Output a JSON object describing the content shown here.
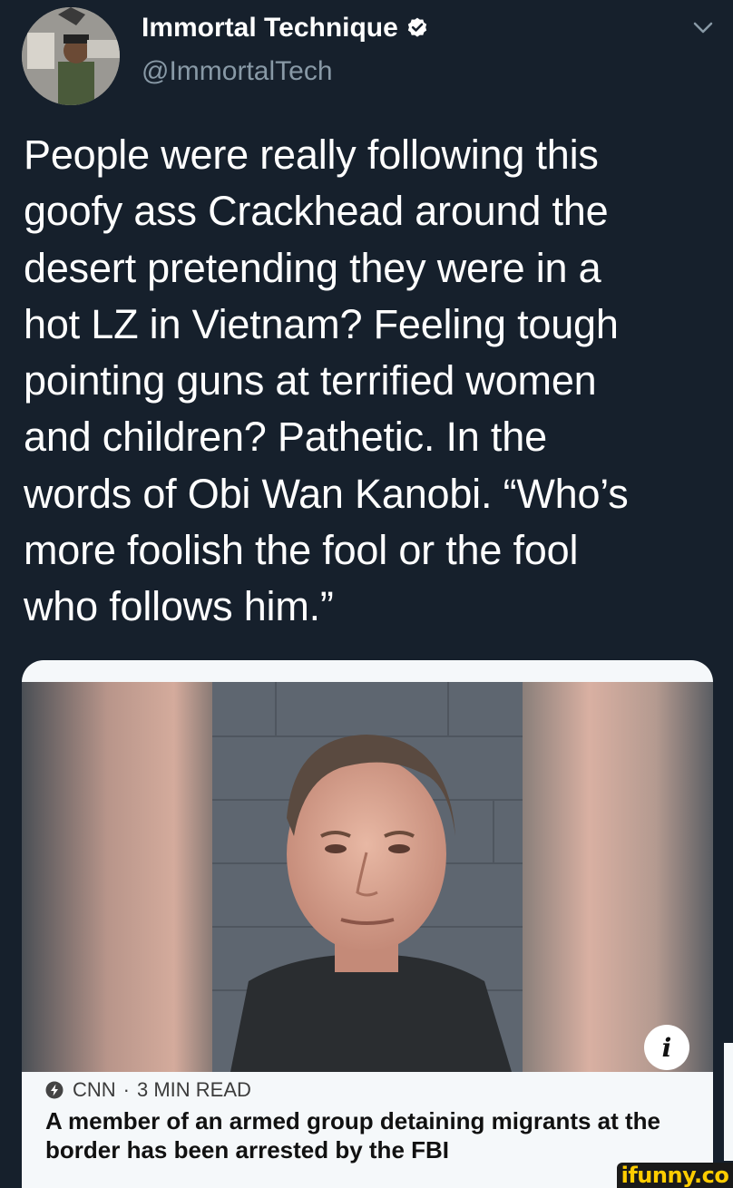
{
  "tweet": {
    "author": {
      "display_name": "Immortal Technique",
      "handle": "@ImmortalTech",
      "verified": true,
      "avatar_icon": "profile-photo"
    },
    "menu_icon": "chevron-down-icon",
    "text": "People were really following this\ngoofy ass Crackhead around the\ndesert pretending they were in a\nhot LZ in Vietnam? Feeling tough\npointing guns at terrified women\nand children? Pathetic. In the\nwords of Obi Wan Kanobi. “Who’s\nmore foolish the fool or the fool\nwho follows him.”"
  },
  "link_card": {
    "source": "CNN",
    "separator": "·",
    "read_time": "3 MIN READ",
    "headline": "A member of an armed group detaining migrants at the border has been arrested by the FBI",
    "info_icon": "i"
  },
  "watermark": {
    "text": "ifunny.co"
  },
  "colors": {
    "background": "#16202c",
    "secondary_text": "#8899a6",
    "verified_blue": "#ffffff",
    "card_background": "#f5f8fa",
    "watermark_yellow": "#ffcc00"
  }
}
